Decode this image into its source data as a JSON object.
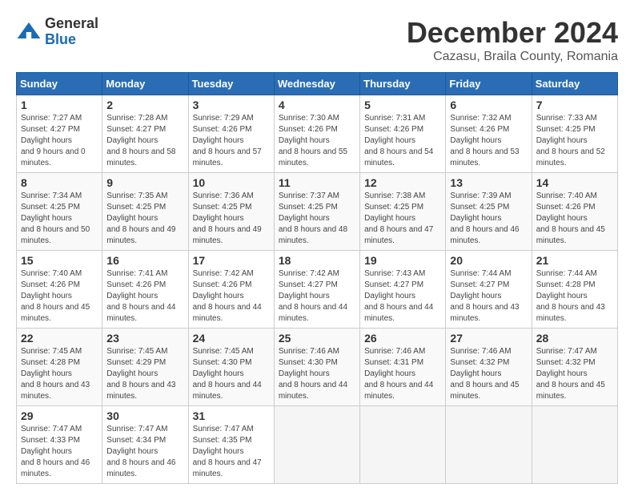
{
  "header": {
    "logo_general": "General",
    "logo_blue": "Blue",
    "month_title": "December 2024",
    "location": "Cazasu, Braila County, Romania"
  },
  "days_of_week": [
    "Sunday",
    "Monday",
    "Tuesday",
    "Wednesday",
    "Thursday",
    "Friday",
    "Saturday"
  ],
  "weeks": [
    [
      {
        "day": "1",
        "sunrise": "7:27 AM",
        "sunset": "4:27 PM",
        "daylight": "9 hours and 0 minutes."
      },
      {
        "day": "2",
        "sunrise": "7:28 AM",
        "sunset": "4:27 PM",
        "daylight": "8 hours and 58 minutes."
      },
      {
        "day": "3",
        "sunrise": "7:29 AM",
        "sunset": "4:26 PM",
        "daylight": "8 hours and 57 minutes."
      },
      {
        "day": "4",
        "sunrise": "7:30 AM",
        "sunset": "4:26 PM",
        "daylight": "8 hours and 55 minutes."
      },
      {
        "day": "5",
        "sunrise": "7:31 AM",
        "sunset": "4:26 PM",
        "daylight": "8 hours and 54 minutes."
      },
      {
        "day": "6",
        "sunrise": "7:32 AM",
        "sunset": "4:26 PM",
        "daylight": "8 hours and 53 minutes."
      },
      {
        "day": "7",
        "sunrise": "7:33 AM",
        "sunset": "4:25 PM",
        "daylight": "8 hours and 52 minutes."
      }
    ],
    [
      {
        "day": "8",
        "sunrise": "7:34 AM",
        "sunset": "4:25 PM",
        "daylight": "8 hours and 50 minutes."
      },
      {
        "day": "9",
        "sunrise": "7:35 AM",
        "sunset": "4:25 PM",
        "daylight": "8 hours and 49 minutes."
      },
      {
        "day": "10",
        "sunrise": "7:36 AM",
        "sunset": "4:25 PM",
        "daylight": "8 hours and 49 minutes."
      },
      {
        "day": "11",
        "sunrise": "7:37 AM",
        "sunset": "4:25 PM",
        "daylight": "8 hours and 48 minutes."
      },
      {
        "day": "12",
        "sunrise": "7:38 AM",
        "sunset": "4:25 PM",
        "daylight": "8 hours and 47 minutes."
      },
      {
        "day": "13",
        "sunrise": "7:39 AM",
        "sunset": "4:25 PM",
        "daylight": "8 hours and 46 minutes."
      },
      {
        "day": "14",
        "sunrise": "7:40 AM",
        "sunset": "4:26 PM",
        "daylight": "8 hours and 45 minutes."
      }
    ],
    [
      {
        "day": "15",
        "sunrise": "7:40 AM",
        "sunset": "4:26 PM",
        "daylight": "8 hours and 45 minutes."
      },
      {
        "day": "16",
        "sunrise": "7:41 AM",
        "sunset": "4:26 PM",
        "daylight": "8 hours and 44 minutes."
      },
      {
        "day": "17",
        "sunrise": "7:42 AM",
        "sunset": "4:26 PM",
        "daylight": "8 hours and 44 minutes."
      },
      {
        "day": "18",
        "sunrise": "7:42 AM",
        "sunset": "4:27 PM",
        "daylight": "8 hours and 44 minutes."
      },
      {
        "day": "19",
        "sunrise": "7:43 AM",
        "sunset": "4:27 PM",
        "daylight": "8 hours and 44 minutes."
      },
      {
        "day": "20",
        "sunrise": "7:44 AM",
        "sunset": "4:27 PM",
        "daylight": "8 hours and 43 minutes."
      },
      {
        "day": "21",
        "sunrise": "7:44 AM",
        "sunset": "4:28 PM",
        "daylight": "8 hours and 43 minutes."
      }
    ],
    [
      {
        "day": "22",
        "sunrise": "7:45 AM",
        "sunset": "4:28 PM",
        "daylight": "8 hours and 43 minutes."
      },
      {
        "day": "23",
        "sunrise": "7:45 AM",
        "sunset": "4:29 PM",
        "daylight": "8 hours and 43 minutes."
      },
      {
        "day": "24",
        "sunrise": "7:45 AM",
        "sunset": "4:30 PM",
        "daylight": "8 hours and 44 minutes."
      },
      {
        "day": "25",
        "sunrise": "7:46 AM",
        "sunset": "4:30 PM",
        "daylight": "8 hours and 44 minutes."
      },
      {
        "day": "26",
        "sunrise": "7:46 AM",
        "sunset": "4:31 PM",
        "daylight": "8 hours and 44 minutes."
      },
      {
        "day": "27",
        "sunrise": "7:46 AM",
        "sunset": "4:32 PM",
        "daylight": "8 hours and 45 minutes."
      },
      {
        "day": "28",
        "sunrise": "7:47 AM",
        "sunset": "4:32 PM",
        "daylight": "8 hours and 45 minutes."
      }
    ],
    [
      {
        "day": "29",
        "sunrise": "7:47 AM",
        "sunset": "4:33 PM",
        "daylight": "8 hours and 46 minutes."
      },
      {
        "day": "30",
        "sunrise": "7:47 AM",
        "sunset": "4:34 PM",
        "daylight": "8 hours and 46 minutes."
      },
      {
        "day": "31",
        "sunrise": "7:47 AM",
        "sunset": "4:35 PM",
        "daylight": "8 hours and 47 minutes."
      },
      null,
      null,
      null,
      null
    ]
  ]
}
